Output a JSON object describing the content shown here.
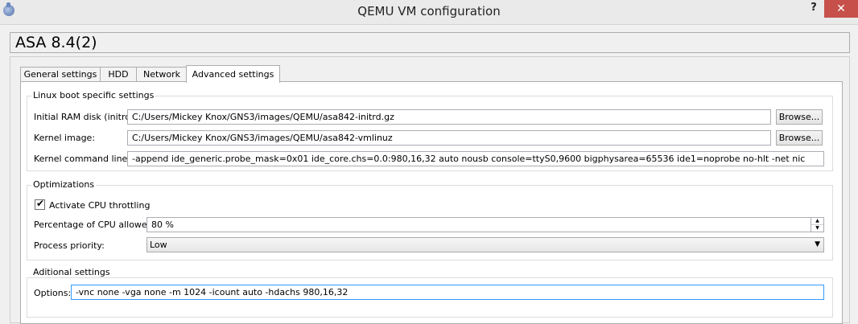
{
  "window": {
    "title": "QEMU VM configuration",
    "help_label": "?",
    "close_label": "✕"
  },
  "vm_name": "ASA 8.4(2)",
  "tabs": [
    {
      "label": "General settings",
      "active": false
    },
    {
      "label": "HDD",
      "active": false
    },
    {
      "label": "Network",
      "active": false
    },
    {
      "label": "Advanced settings",
      "active": true
    }
  ],
  "linux_boot": {
    "group_title": "Linux boot specific settings",
    "initrd_label": "Initial RAM disk (initrd):",
    "initrd_value": "C:/Users/Mickey Knox/GNS3/images/QEMU/asa842-initrd.gz",
    "kernel_image_label": "Kernel image:",
    "kernel_image_value": "C:/Users/Mickey Knox/GNS3/images/QEMU/asa842-vmlinuz",
    "kernel_cmdline_label": "Kernel command line:",
    "kernel_cmdline_value": "-append ide_generic.probe_mask=0x01 ide_core.chs=0.0:980,16,32 auto nousb console=ttyS0,9600 bigphysarea=65536 ide1=noprobe no-hlt -net nic",
    "browse_label": "Browse..."
  },
  "optimizations": {
    "group_title": "Optimizations",
    "cpu_throttling_label": "Activate CPU throttling",
    "cpu_throttling_checked": true,
    "cpu_percent_label": "Percentage of CPU allowed:",
    "cpu_percent_value": "80 %",
    "priority_label": "Process priority:",
    "priority_value": "Low"
  },
  "additional": {
    "group_title": "Aditional settings",
    "options_label": "Options:",
    "options_value": "-vnc none -vga none -m 1024 -icount auto -hdachs 980,16,32"
  },
  "colors": {
    "close_button": "#c7504a",
    "focus_border": "#3399ff"
  }
}
